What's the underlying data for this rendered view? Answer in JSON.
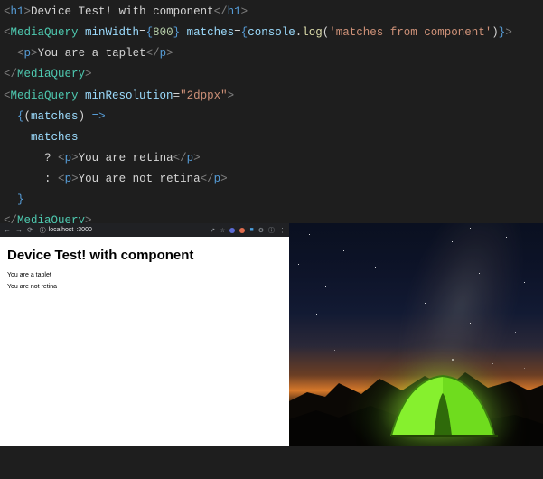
{
  "code": {
    "line1": {
      "open_tag": "h1",
      "text": "Device Test! with component",
      "close_tag": "h1"
    },
    "line2": {
      "tag": "MediaQuery",
      "attr1": "minWidth",
      "num": "800",
      "attr2": "matches",
      "obj": "console",
      "meth": "log",
      "str": "'matches from component'"
    },
    "line3": {
      "tag": "p",
      "text": "You are a taplet"
    },
    "line4": {
      "close": "MediaQuery"
    },
    "line5": {
      "tag": "MediaQuery",
      "attr": "minResolution",
      "val": "\"2dppx\""
    },
    "line6": {
      "param": "matches",
      "arrow": "=>"
    },
    "line7": {
      "ident": "matches"
    },
    "line8": {
      "q": "?",
      "tag": "p",
      "text": "You are retina"
    },
    "line9": {
      "q": ":",
      "tag": "p",
      "text": "You are not retina"
    },
    "line10_close": "MediaQuery"
  },
  "browser": {
    "url_host": "localhost",
    "url_port": ":3000",
    "heading": "Device Test! with component",
    "p1": "You are a taplet",
    "p2": "You are not retina"
  },
  "colors": {
    "react_blue": "#5ec7f8",
    "orange_dot": "#e06c4d"
  }
}
